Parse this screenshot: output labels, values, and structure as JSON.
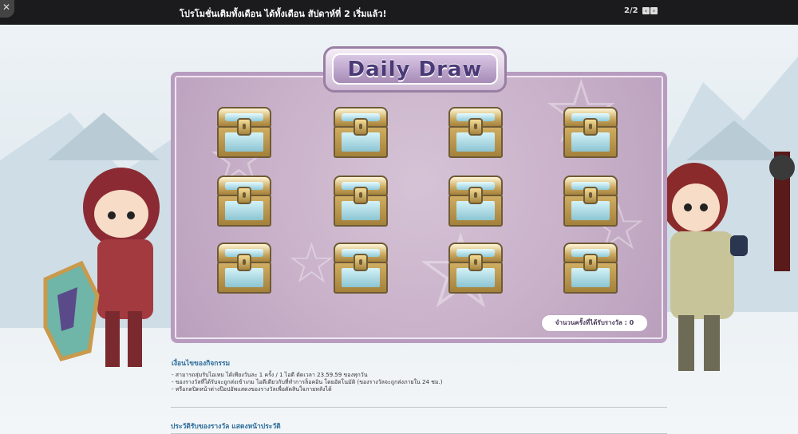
{
  "topbar": {
    "title": "โปรโมชั่นเติมทั้งเดือน ได้ทั้งเดือน สัปดาห์ที่ 2 เริ่มแล้ว!",
    "pager": "2/2",
    "prev_icon": "chevron-left-icon",
    "next_icon": "chevron-right-icon"
  },
  "board": {
    "title": "Daily Draw",
    "chest_count": 12,
    "counter_label": "จำนวนครั้งที่ได้รับรางวัล : 0"
  },
  "conditions": {
    "heading": "เงื่อนไขของกิจกรรม",
    "lines": [
      "- สามารถสุ่มรับไอเทม ได้เพียงวันละ 1 ครั้ง / 1 ไอดี ตัดเวลา 23.59.59 ของทุกวัน",
      "- ของรางวัลที่ได้รับจะถูกส่งเข้าเกม ไอดีเดียวกับที่ทำการล็อคอิน โดยอัตโนมัติ (ของรางวัลจะถูกส่งภายใน 24 ชม.)",
      "- หรือกดปิดหน้าต่างป๊อปอัพแสดงของรางวัลเพื่อตัดสินใจภายหลังได้"
    ]
  },
  "prize_history_label": "ประวัติรับของรางวัล แสดงหน้าประวัติ",
  "colors": {
    "topbar": "#1b1b1d",
    "board_border": "#b89cc0",
    "title_text": "#4b3a77",
    "link": "#2a6b9a"
  }
}
